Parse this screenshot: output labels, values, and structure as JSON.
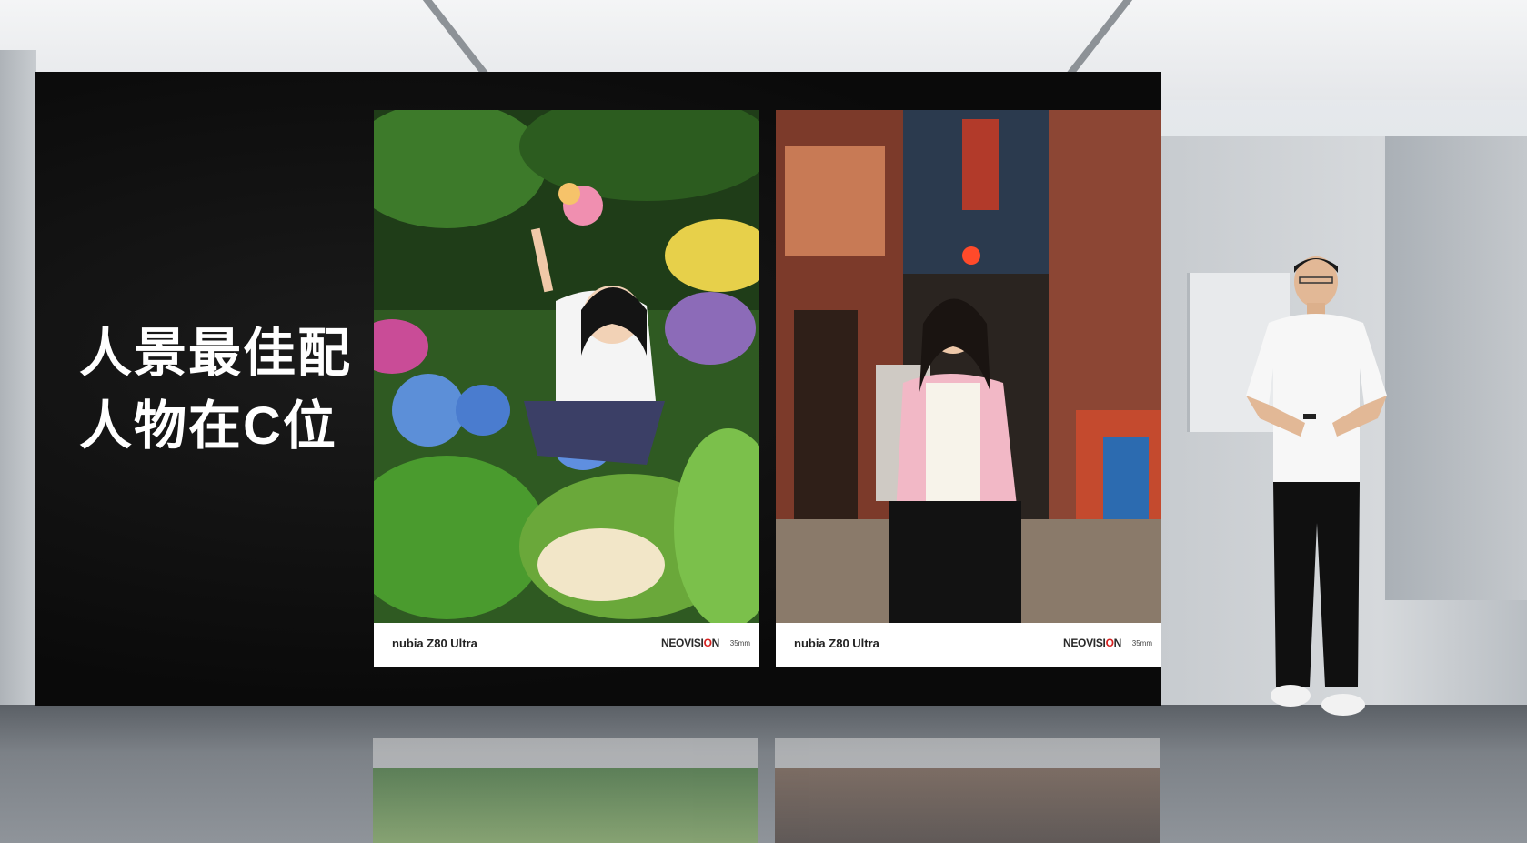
{
  "headline": {
    "line1": "人景最佳配",
    "line2": "人物在C位"
  },
  "photos": [
    {
      "model": "nubia Z80 Ultra",
      "brand": {
        "prefix": "NEOVISI",
        "mark": "O",
        "suffix": "N"
      },
      "focal": "35mm"
    },
    {
      "model": "nubia Z80 Ultra",
      "brand": {
        "prefix": "NEOVISI",
        "mark": "O",
        "suffix": "N"
      },
      "focal": "35mm"
    }
  ],
  "colors": {
    "screen": "#0a0a0a",
    "brand_accent": "#d6201f"
  }
}
